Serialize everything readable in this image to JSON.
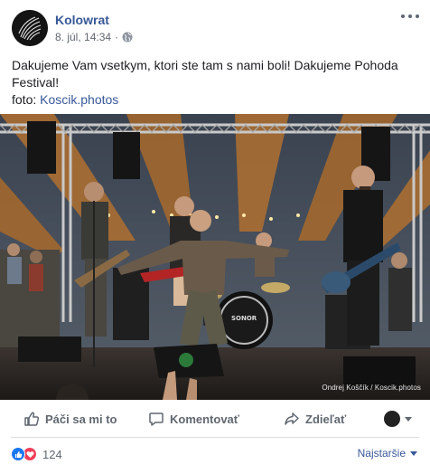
{
  "post": {
    "page_name": "Kolowrat",
    "timestamp": "8. júl, 14:34",
    "separator": "·",
    "audience_icon": "globe-icon",
    "text_line": "Dakujeme Vam vsetkym, ktori ste tam s nami boli! Dakujeme Pohoda Festival!",
    "photo_label": "foto:",
    "photo_link": "Koscik.photos",
    "photo_credit": "Ondrej Koščík / Koscik.photos"
  },
  "actions": {
    "like_label": "Páči sa mi to",
    "comment_label": "Komentovať",
    "share_label": "Zdieľať"
  },
  "reactions": {
    "count": "124",
    "sort_label": "Najstaršie",
    "types": [
      "like",
      "love"
    ]
  },
  "colors": {
    "link": "#385898",
    "secondary_text": "#606770",
    "like_blue": "#1877f2",
    "love_red": "#f33e58"
  }
}
